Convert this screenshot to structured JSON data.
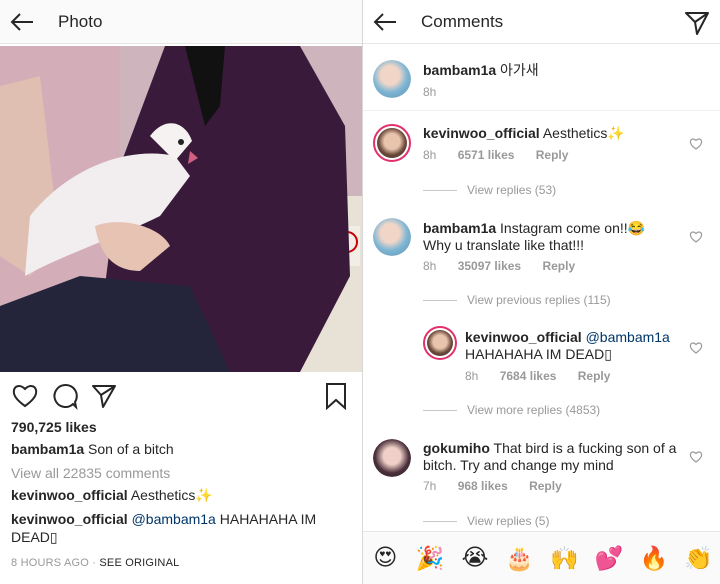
{
  "left": {
    "title": "Photo",
    "likes": "790,725 likes",
    "caption": {
      "user": "bambam1a",
      "text": "Son of a bitch"
    },
    "view_all": "View all 22835 comments",
    "comment1": {
      "user": "kevinwoo_official",
      "text": "Aesthetics✨"
    },
    "comment2": {
      "user": "kevinwoo_official",
      "mention": "@bambam1a",
      "text": " HAHAHAHA IM",
      "text2": "DEAD▯"
    },
    "time": "8 HOURS AGO",
    "see_original": "SEE ORIGINAL"
  },
  "right": {
    "title": "Comments",
    "comments": [
      {
        "user": "bambam1a",
        "text": "아가새",
        "time": "8h"
      },
      {
        "user": "kevinwoo_official",
        "text": "Aesthetics✨",
        "time": "8h",
        "likes": "6571 likes",
        "reply": "Reply",
        "view": "View replies (53)"
      },
      {
        "user": "bambam1a",
        "text": "Instagram come on!!😂",
        "text2": "Why u translate like that!!!",
        "time": "8h",
        "likes": "35097 likes",
        "reply": "Reply",
        "view": "View previous replies (115)"
      },
      {
        "user": "kevinwoo_official",
        "mention": "@bambam1a",
        "text2": "HAHAHAHA IM DEAD▯",
        "time": "8h",
        "likes": "7684 likes",
        "reply": "Reply",
        "view": "View more replies (4853)"
      },
      {
        "user": "gokumiho",
        "text": "That bird is a fucking son of a",
        "text2": "bitch. Try and change my mind",
        "time": "7h",
        "likes": "968 likes",
        "reply": "Reply",
        "view": "View replies (5)"
      }
    ],
    "emojis": [
      "😍",
      "🎉",
      "😭",
      "🎂",
      "🙌",
      "💕",
      "🔥",
      "👏"
    ]
  },
  "colors": {
    "link": "#003569",
    "meta": "#999999",
    "ring": "#e1306c"
  }
}
